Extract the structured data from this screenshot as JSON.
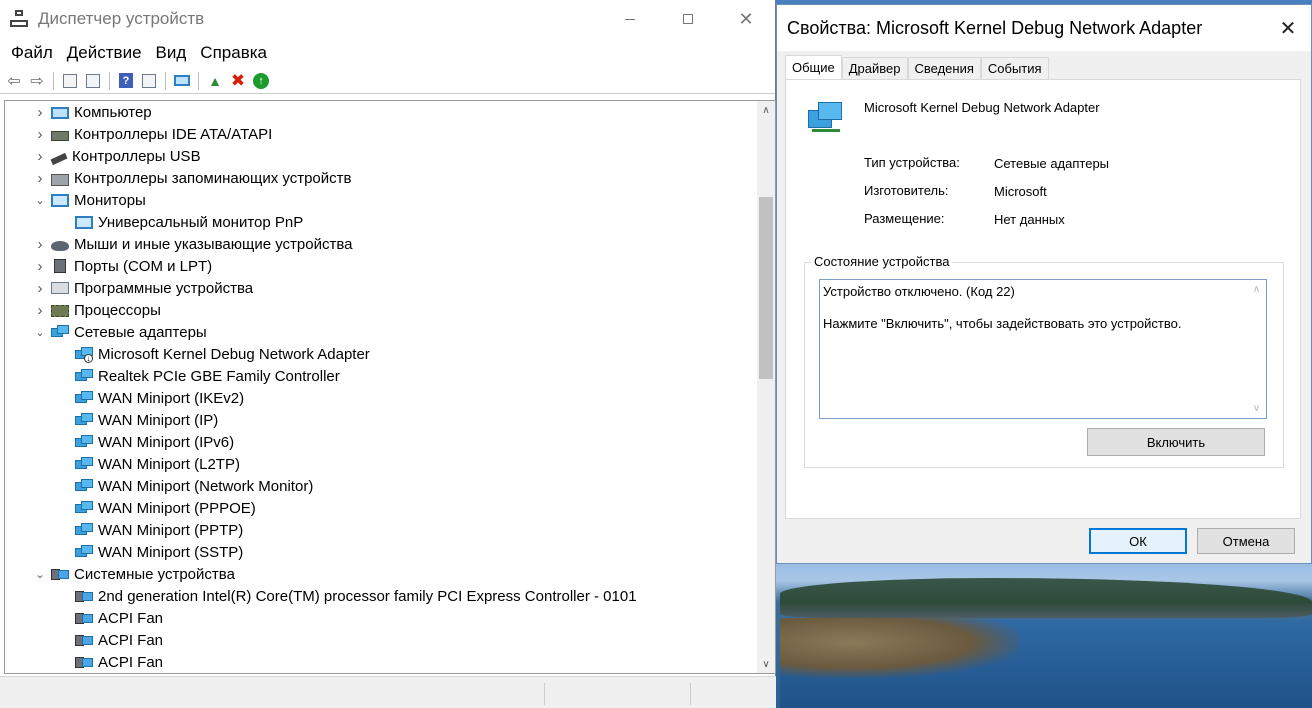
{
  "device_manager": {
    "title": "Диспетчер устройств",
    "menu": [
      "Файл",
      "Действие",
      "Вид",
      "Справка"
    ],
    "tree": [
      {
        "label": "Компьютер",
        "level": 0,
        "expanded": false,
        "icon": "computer-icon"
      },
      {
        "label": "Контроллеры IDE ATA/ATAPI",
        "level": 0,
        "expanded": false,
        "icon": "ide-controller-icon"
      },
      {
        "label": "Контроллеры USB",
        "level": 0,
        "expanded": false,
        "icon": "usb-icon"
      },
      {
        "label": "Контроллеры запоминающих устройств",
        "level": 0,
        "expanded": false,
        "icon": "storage-controller-icon"
      },
      {
        "label": "Мониторы",
        "level": 0,
        "expanded": true,
        "icon": "monitor-icon"
      },
      {
        "label": "Универсальный монитор PnP",
        "level": 1,
        "icon": "monitor-icon"
      },
      {
        "label": "Мыши и иные указывающие устройства",
        "level": 0,
        "expanded": false,
        "icon": "mouse-icon"
      },
      {
        "label": "Порты (COM и LPT)",
        "level": 0,
        "expanded": false,
        "icon": "port-icon"
      },
      {
        "label": "Программные устройства",
        "level": 0,
        "expanded": false,
        "icon": "software-device-icon"
      },
      {
        "label": "Процессоры",
        "level": 0,
        "expanded": false,
        "icon": "processor-icon"
      },
      {
        "label": "Сетевые адаптеры",
        "level": 0,
        "expanded": true,
        "icon": "network-adapter-icon"
      },
      {
        "label": "Microsoft Kernel Debug Network Adapter",
        "level": 1,
        "icon": "network-adapter-disabled-icon"
      },
      {
        "label": "Realtek PCIe GBE Family Controller",
        "level": 1,
        "icon": "network-adapter-icon"
      },
      {
        "label": "WAN Miniport (IKEv2)",
        "level": 1,
        "icon": "network-adapter-icon"
      },
      {
        "label": "WAN Miniport (IP)",
        "level": 1,
        "icon": "network-adapter-icon"
      },
      {
        "label": "WAN Miniport (IPv6)",
        "level": 1,
        "icon": "network-adapter-icon"
      },
      {
        "label": "WAN Miniport (L2TP)",
        "level": 1,
        "icon": "network-adapter-icon"
      },
      {
        "label": "WAN Miniport (Network Monitor)",
        "level": 1,
        "icon": "network-adapter-icon"
      },
      {
        "label": "WAN Miniport (PPPOE)",
        "level": 1,
        "icon": "network-adapter-icon"
      },
      {
        "label": "WAN Miniport (PPTP)",
        "level": 1,
        "icon": "network-adapter-icon"
      },
      {
        "label": "WAN Miniport (SSTP)",
        "level": 1,
        "icon": "network-adapter-icon"
      },
      {
        "label": "Системные устройства",
        "level": 0,
        "expanded": true,
        "icon": "system-device-icon"
      },
      {
        "label": "2nd generation Intel(R) Core(TM) processor family PCI Express Controller - 0101",
        "level": 1,
        "icon": "system-device-icon"
      },
      {
        "label": "ACPI Fan",
        "level": 1,
        "icon": "system-device-icon"
      },
      {
        "label": "ACPI Fan",
        "level": 1,
        "icon": "system-device-icon"
      },
      {
        "label": "ACPI Fan",
        "level": 1,
        "icon": "system-device-icon"
      }
    ]
  },
  "properties_dialog": {
    "title": "Свойства: Microsoft Kernel Debug Network Adapter",
    "tabs": [
      "Общие",
      "Драйвер",
      "Сведения",
      "События"
    ],
    "active_tab": "Общие",
    "device_name": "Microsoft Kernel Debug Network Adapter",
    "properties": [
      {
        "label": "Тип устройства:",
        "value": "Сетевые адаптеры"
      },
      {
        "label": "Изготовитель:",
        "value": "Microsoft"
      },
      {
        "label": "Размещение:",
        "value": "Нет данных"
      }
    ],
    "status_group_label": "Состояние устройства",
    "status_line1": "Устройство отключено. (Код 22)",
    "status_line2": "Нажмите \"Включить\", чтобы задействовать это устройство.",
    "enable_button": "Включить",
    "ok_button": "ОК",
    "cancel_button": "Отмена"
  },
  "colors": {
    "accent": "#0078d7",
    "delete_red": "#d81e05",
    "enable_green": "#1c9b2c"
  }
}
